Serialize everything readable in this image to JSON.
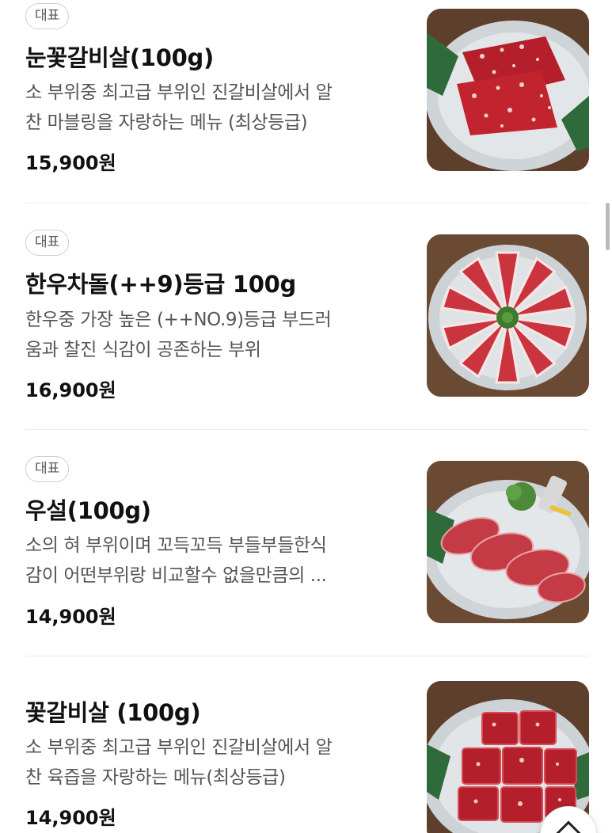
{
  "menu": {
    "items": [
      {
        "badge": "대표",
        "name": "눈꽃갈비살(100g)",
        "desc_line1": "소 부위중 최고급 부위인 진갈비살에서 알",
        "desc_line2": "찬 마블링을 자랑하는 메뉴 (최상등급)",
        "price": "15,900원",
        "photo_icon": "marbled-beef-slices-on-glass-plate"
      },
      {
        "badge": "대표",
        "name": "한우차돌(++9)등급 100g",
        "desc_line1": "한우중 가장 높은 (++NO.9)등급 부드러",
        "desc_line2": "움과 찰진 식감이 공존하는 부위",
        "price": "16,900원",
        "photo_icon": "beef-brisket-flower-arrangement"
      },
      {
        "badge": "대표",
        "name": "우설(100g)",
        "desc_line1": "소의 혀 부위이며 꼬득꼬득 부들부들한식",
        "desc_line2": "감이 어떤부위랑 비교할수 없을만큼의 ...",
        "price": "14,900원",
        "photo_icon": "beef-tongue-slices-with-garnish"
      },
      {
        "badge": "",
        "name": "꽃갈비살 (100g)",
        "desc_line1": "소 부위중 최고급 부위인 진갈비살에서 알",
        "desc_line2": "찬 육즙을 자랑하는 메뉴(최상등급)",
        "price": "14,900원",
        "photo_icon": "rib-meat-cubes-on-glass-plate"
      }
    ]
  },
  "scroll_top_icon": "chevron-up-icon",
  "colors": {
    "meat_red": "#b8202c",
    "marbling": "#f4d7d5",
    "plate_glass": "#d9dde0",
    "wood_table": "#6b4a34",
    "leaf_green": "#2f6b3a"
  }
}
